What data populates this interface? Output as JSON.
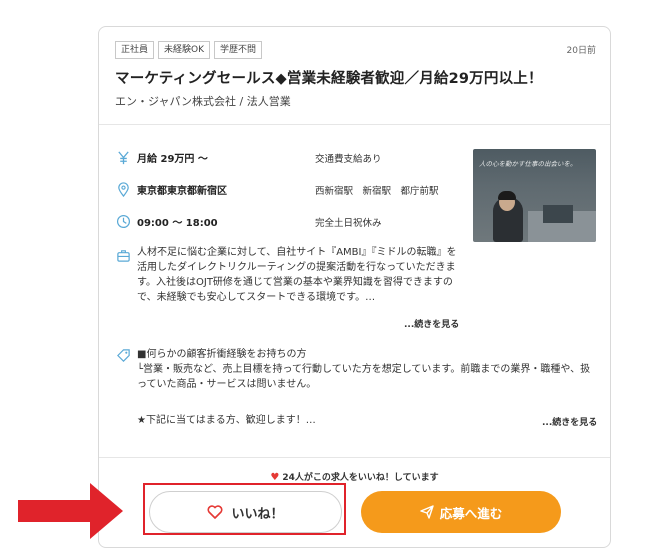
{
  "job": {
    "tags": [
      "正社員",
      "未経験OK",
      "学歴不問"
    ],
    "posted": "20日前",
    "title": "マーケティングセールス◆営業未経験者歓迎／月給29万円以上！",
    "company": "エン・ジャパン株式会社 / 法人営業",
    "salary": "月給 29万円 〜",
    "salary_note": "交通費支給あり",
    "location": "東京都東京都新宿区",
    "stations": "西新宿駅　新宿駅　都庁前駅",
    "hours": "09:00 〜 18:00",
    "holidays": "完全土日祝休み",
    "description": "人材不足に悩む企業に対して、自社サイト『AMBI』『ミドルの転職』を活用したダイレクトリクルーティングの提案活動を行なっていただきます。入社後はOJT研修を通じて営業の基本や業界知識を習得できますので、未経験でも安心してスタートできる環境です。…",
    "description_more": "...続きを見る",
    "requirements_heading": "■何らかの顧客折衝経験をお持ちの方",
    "requirements_body": "└営業・販売など、売上目標を持って行動していた方を想定しています。前職までの業界・職種や、扱っていた商品・サービスは問いません。",
    "requirements_extra": "★下記に当てはまる方、歓迎します！…",
    "requirements_more": "...続きを見る",
    "photo_text": "人の心を動かす仕事の出会いを。"
  },
  "actions": {
    "likes_text": "24人がこの求人をいいね！しています",
    "like_label": "いいね！",
    "apply_label": "応募へ進む"
  },
  "colors": {
    "accent_icon": "#5aa9d6",
    "apply_button": "#f59a1b",
    "heart": "#e53935",
    "highlight": "#e0232b"
  }
}
